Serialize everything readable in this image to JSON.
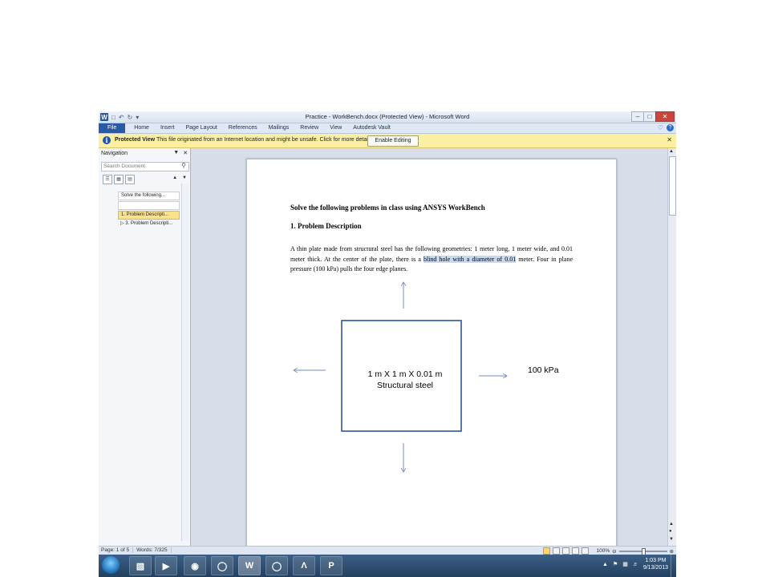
{
  "window": {
    "title": "Practice - WorkBench.docx (Protected View) - Microsoft Word",
    "app_icon": "W"
  },
  "ribbon": {
    "tabs": [
      "File",
      "Home",
      "Insert",
      "Page Layout",
      "References",
      "Mailings",
      "Review",
      "View",
      "Autodesk Vault"
    ]
  },
  "infobar": {
    "label": "Protected View",
    "message": "This file originated from an Internet location and might be unsafe. Click for more details.",
    "button": "Enable Editing"
  },
  "navigation": {
    "title": "Navigation",
    "search_placeholder": "Search Document",
    "items": [
      {
        "label": "Solve the following...",
        "selected": false
      },
      {
        "label": "",
        "selected": false
      },
      {
        "label": "1. Problem Descripti...",
        "selected": true
      },
      {
        "label": "▷ 3. Problem Descripti...",
        "selected": false
      }
    ]
  },
  "document": {
    "heading": "Solve the following problems in class using ANSYS WorkBench",
    "section": "1. Problem Description",
    "para_before": "A thin plate made from structural steel has the following geometries: 1 meter long, 1 meter wide, and 0.01 meter thick. At the center of the plate, there is a ",
    "para_highlight": "blind hole with a diameter of 0.01",
    "para_after": " meter. Four  in plane pressure (100 kPa) pulls the four edge planes.",
    "figure": {
      "box_line1": "1 m X 1 m X 0.01 m",
      "box_line2": "Structural steel",
      "pressure_label": "100 kPa"
    }
  },
  "status": {
    "page": "Page: 1 of 5",
    "words": "Words: 7/325",
    "zoom": "100%"
  },
  "taskbar": {
    "time": "1:03 PM",
    "date": "9/13/2013"
  },
  "colors": {
    "file_tab": "#2a5aa6",
    "infobar": "#fbf0a2",
    "figure_box": "#2f5597",
    "arrow": "#6f8fbf",
    "highlight": "#c6d9f1"
  }
}
